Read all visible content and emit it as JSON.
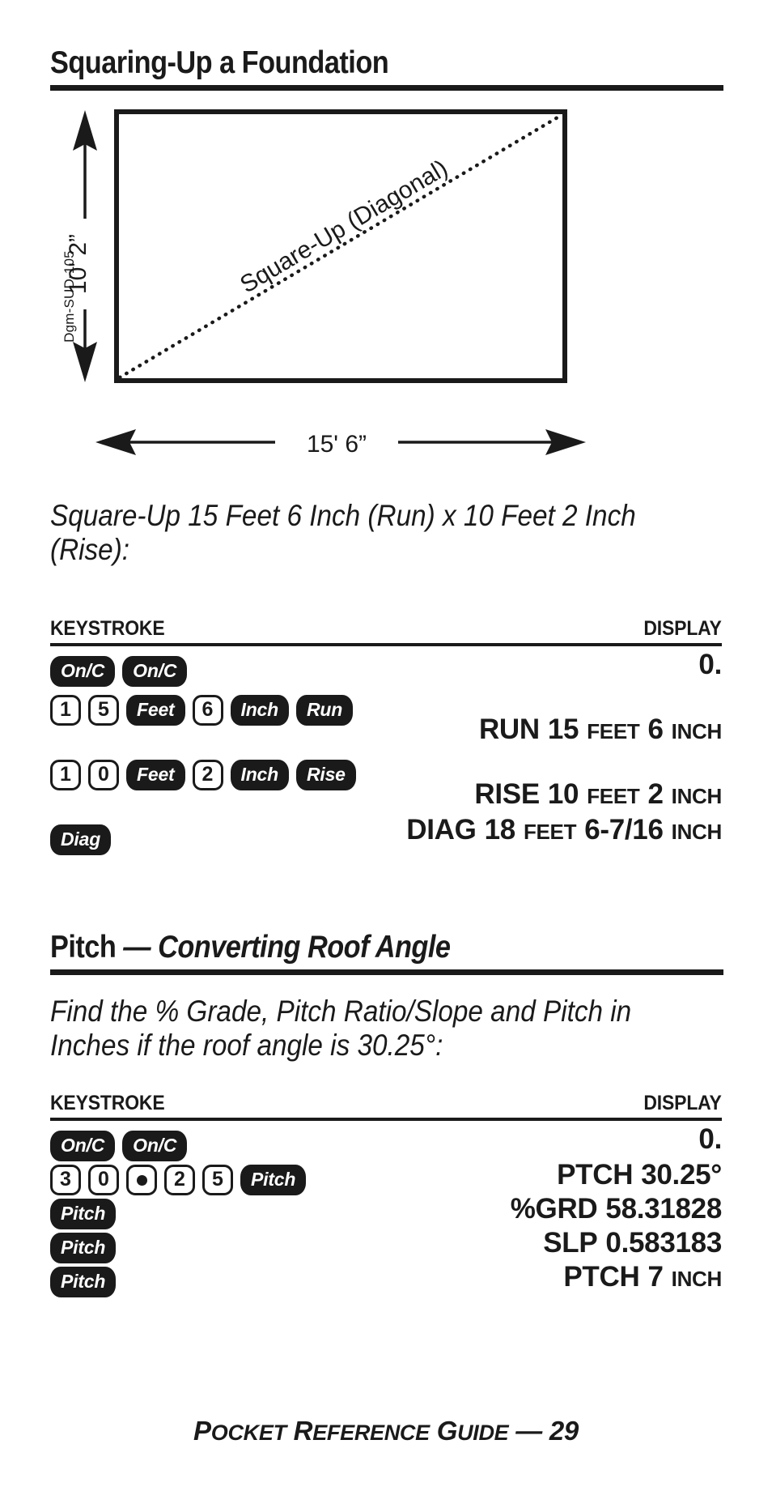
{
  "page": {
    "footer_prefix_cap": "P",
    "footer_word1_rest": "OCKET",
    "footer_cap2": "R",
    "footer_word2_rest": "EFERENCE",
    "footer_cap3": "G",
    "footer_word3_rest": "UIDE",
    "footer_dash": "— 29"
  },
  "sections": [
    {
      "heading_plain": "Squaring-Up a Foundation",
      "heading_italic": "",
      "intro": "Square-Up 15 Feet 6 Inch (Run) x 10 Feet 2 Inch (Rise):",
      "table": {
        "col_keystroke": "KEYSTROKE",
        "col_display": "DISPLAY",
        "rows": [
          {
            "keys": [
              {
                "type": "fn",
                "label": "On/C"
              },
              {
                "type": "fn",
                "label": "On/C"
              }
            ],
            "display": [
              {
                "text": "0.",
                "size": "big"
              }
            ]
          },
          {
            "keys": [
              {
                "type": "num",
                "label": "1"
              },
              {
                "type": "num",
                "label": "5"
              },
              {
                "type": "fn",
                "label": "Feet"
              },
              {
                "type": "num",
                "label": "6"
              },
              {
                "type": "fn",
                "label": "Inch"
              },
              {
                "type": "fn",
                "label": "Run"
              }
            ],
            "display": [
              {
                "text": "RUN",
                "size": "big"
              },
              {
                "text": "15",
                "size": "big"
              },
              {
                "text": "FEET",
                "size": "small"
              },
              {
                "text": "6",
                "size": "big"
              },
              {
                "text": "INCH",
                "size": "small"
              }
            ]
          },
          {
            "keys": [
              {
                "type": "num",
                "label": "1"
              },
              {
                "type": "num",
                "label": "0"
              },
              {
                "type": "fn",
                "label": "Feet"
              },
              {
                "type": "num",
                "label": "2"
              },
              {
                "type": "fn",
                "label": "Inch"
              },
              {
                "type": "fn",
                "label": "Rise"
              }
            ],
            "display": [
              {
                "text": "RISE",
                "size": "big"
              },
              {
                "text": "10",
                "size": "big"
              },
              {
                "text": "FEET",
                "size": "small"
              },
              {
                "text": "2",
                "size": "big"
              },
              {
                "text": "INCH",
                "size": "small"
              }
            ]
          },
          {
            "keys": [
              {
                "type": "fn",
                "label": "Diag"
              }
            ],
            "display": [
              {
                "text": "DIAG",
                "size": "big"
              },
              {
                "text": "18",
                "size": "big"
              },
              {
                "text": "FEET",
                "size": "small"
              },
              {
                "text": "6-7/16",
                "size": "big"
              },
              {
                "text": "INCH",
                "size": "small"
              }
            ]
          }
        ]
      }
    },
    {
      "heading_plain": "Pitch ",
      "heading_italic": "— Converting Roof Angle",
      "intro": "Find the % Grade, Pitch Ratio/Slope and Pitch in Inches if the roof angle is 30.25°:",
      "table": {
        "col_keystroke": "KEYSTROKE",
        "col_display": "DISPLAY",
        "rows": [
          {
            "keys": [
              {
                "type": "fn",
                "label": "On/C"
              },
              {
                "type": "fn",
                "label": "On/C"
              }
            ],
            "display": [
              {
                "text": "0.",
                "size": "big"
              }
            ]
          },
          {
            "keys": [
              {
                "type": "num",
                "label": "3"
              },
              {
                "type": "num",
                "label": "0"
              },
              {
                "type": "dot",
                "label": "."
              },
              {
                "type": "num",
                "label": "2"
              },
              {
                "type": "num",
                "label": "5"
              },
              {
                "type": "fn",
                "label": "Pitch"
              }
            ],
            "display": [
              {
                "text": "PTCH",
                "size": "big"
              },
              {
                "text": "30.25°",
                "size": "big"
              }
            ]
          },
          {
            "keys": [
              {
                "type": "fn",
                "label": "Pitch"
              }
            ],
            "display": [
              {
                "text": "%GRD",
                "size": "big"
              },
              {
                "text": "58.31828",
                "size": "big"
              }
            ]
          },
          {
            "keys": [
              {
                "type": "fn",
                "label": "Pitch"
              }
            ],
            "display": [
              {
                "text": "SLP",
                "size": "big"
              },
              {
                "text": "0.583183",
                "size": "big"
              }
            ]
          },
          {
            "keys": [
              {
                "type": "fn",
                "label": "Pitch"
              }
            ],
            "display": [
              {
                "text": "PTCH",
                "size": "big"
              },
              {
                "text": "7",
                "size": "big"
              },
              {
                "text": "INCH",
                "size": "small"
              }
            ]
          }
        ]
      }
    }
  ],
  "diagram": {
    "code_label": "Dgm-SUD-105",
    "height_label": "10' 2”",
    "width_label": "15' 6”",
    "diagonal_label": "Square-Up (Diagonal)"
  }
}
